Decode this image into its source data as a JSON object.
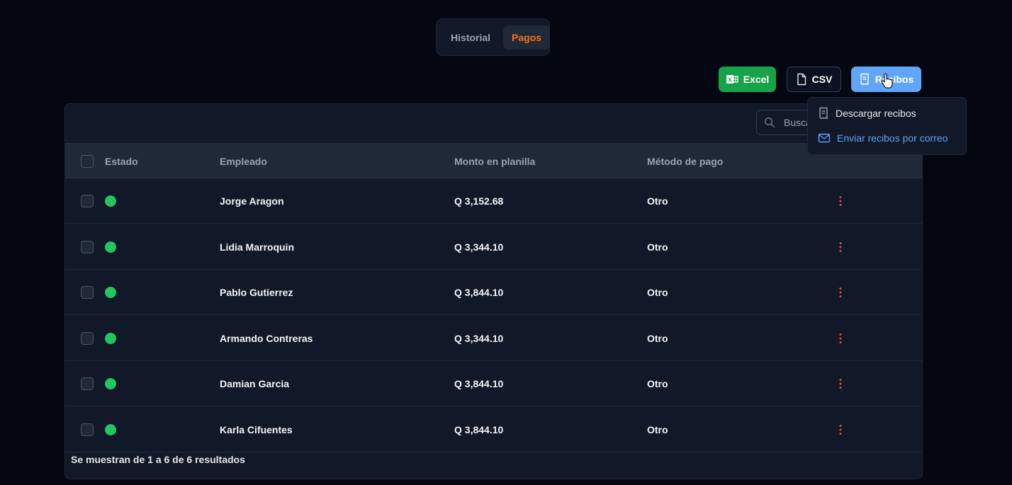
{
  "tabs": [
    {
      "label": "Historial",
      "active": false
    },
    {
      "label": "Pagos",
      "active": true
    }
  ],
  "actions": {
    "excel": {
      "label": "Excel",
      "icon": "excel-icon",
      "color": "#16a34a"
    },
    "csv": {
      "label": "CSV",
      "icon": "file-icon"
    },
    "recibos": {
      "label": "Recibos",
      "icon": "receipt-icon",
      "color": "#60a5fa"
    }
  },
  "dropdown": {
    "items": [
      {
        "label": "Descargar recibos",
        "icon": "receipt-icon"
      },
      {
        "label": "Enviar recibos por correo",
        "icon": "mail-icon",
        "color": "#60a5fa"
      }
    ]
  },
  "search": {
    "placeholder": "Buscar"
  },
  "table": {
    "columns": [
      "Estado",
      "Empleado",
      "Monto en planilla",
      "Método de pago"
    ],
    "rows": [
      {
        "status": "green",
        "name": "Jorge Aragon",
        "amount": "Q 3,152.68",
        "method": "Otro"
      },
      {
        "status": "green",
        "name": "Lidia Marroquin",
        "amount": "Q 3,344.10",
        "method": "Otro"
      },
      {
        "status": "green",
        "name": "Pablo Gutierrez",
        "amount": "Q 3,844.10",
        "method": "Otro"
      },
      {
        "status": "green",
        "name": "Armando Contreras",
        "amount": "Q 3,344.10",
        "method": "Otro"
      },
      {
        "status": "green",
        "name": "Damian Garcia",
        "amount": "Q 3,844.10",
        "method": "Otro"
      },
      {
        "status": "green",
        "name": "Karla Cifuentes",
        "amount": "Q 3,844.10",
        "method": "Otro"
      }
    ],
    "footer": "Se muestran de 1 a 6 de 6 resultados"
  },
  "colors": {
    "status_green": "#22c55e",
    "accent_orange": "#f97316",
    "kebab_red": "#ef4444"
  }
}
